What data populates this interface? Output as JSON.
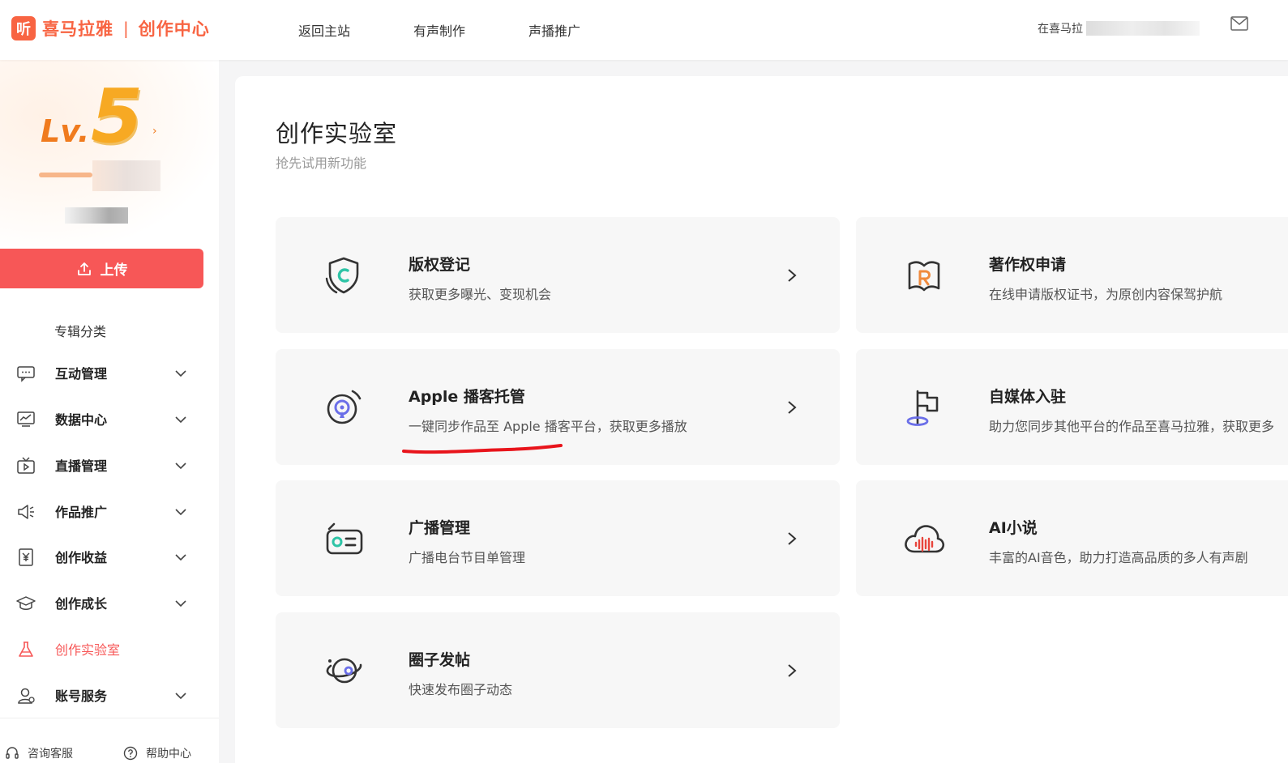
{
  "header": {
    "logo_mark": "听",
    "brand": "喜马拉雅",
    "separator": "|",
    "sub_brand": "创作中心",
    "nav": [
      "返回主站",
      "有声制作",
      "声播推广"
    ],
    "user_prefix": "在喜马拉"
  },
  "sidebar": {
    "level_prefix": "Lv.",
    "level_value": "5",
    "level_arrow": "›",
    "upload_label": "上传",
    "plain_item": "专辑分类",
    "items": [
      {
        "label": "互动管理",
        "icon": "chat-icon"
      },
      {
        "label": "数据中心",
        "icon": "chart-icon"
      },
      {
        "label": "直播管理",
        "icon": "tv-icon"
      },
      {
        "label": "作品推广",
        "icon": "megaphone-icon"
      },
      {
        "label": "创作收益",
        "icon": "yuan-icon"
      },
      {
        "label": "创作成长",
        "icon": "graduation-cap-icon"
      },
      {
        "label": "创作实验室",
        "icon": "flask-icon"
      },
      {
        "label": "账号服务",
        "icon": "user-icon"
      }
    ],
    "footer": [
      "咨询客服",
      "帮助中心"
    ],
    "active_color": "#f75757"
  },
  "main": {
    "title": "创作实验室",
    "subtitle": "抢先试用新功能",
    "cards": [
      {
        "title": "版权登记",
        "desc": "获取更多曝光、变现机会",
        "icon": "shield-c-icon"
      },
      {
        "title": "著作权申请",
        "desc": "在线申请版权证书，为原创内容保驾护航",
        "icon": "book-r-icon"
      },
      {
        "title": "Apple 播客托管",
        "desc": "一键同步作品至 Apple 播客平台，获取更多播放",
        "icon": "podcast-icon"
      },
      {
        "title": "自媒体入驻",
        "desc": "助力您同步其他平台的作品至喜马拉雅，获取更多",
        "icon": "flag-icon"
      },
      {
        "title": "广播管理",
        "desc": "广播电台节目单管理",
        "icon": "radio-icon"
      },
      {
        "title": "AI小说",
        "desc": "丰富的AI音色，助力打造高品质的多人有声剧",
        "icon": "cloud-wave-icon"
      },
      {
        "title": "圈子发帖",
        "desc": "快速发布圈子动态",
        "icon": "planet-icon"
      }
    ]
  },
  "colors": {
    "brand": "#f86442",
    "upload": "#f75757",
    "teal": "#2ec4a6",
    "orange": "#f08a3c",
    "purple": "#6b6fe8",
    "annotation_red": "#e8141b"
  }
}
